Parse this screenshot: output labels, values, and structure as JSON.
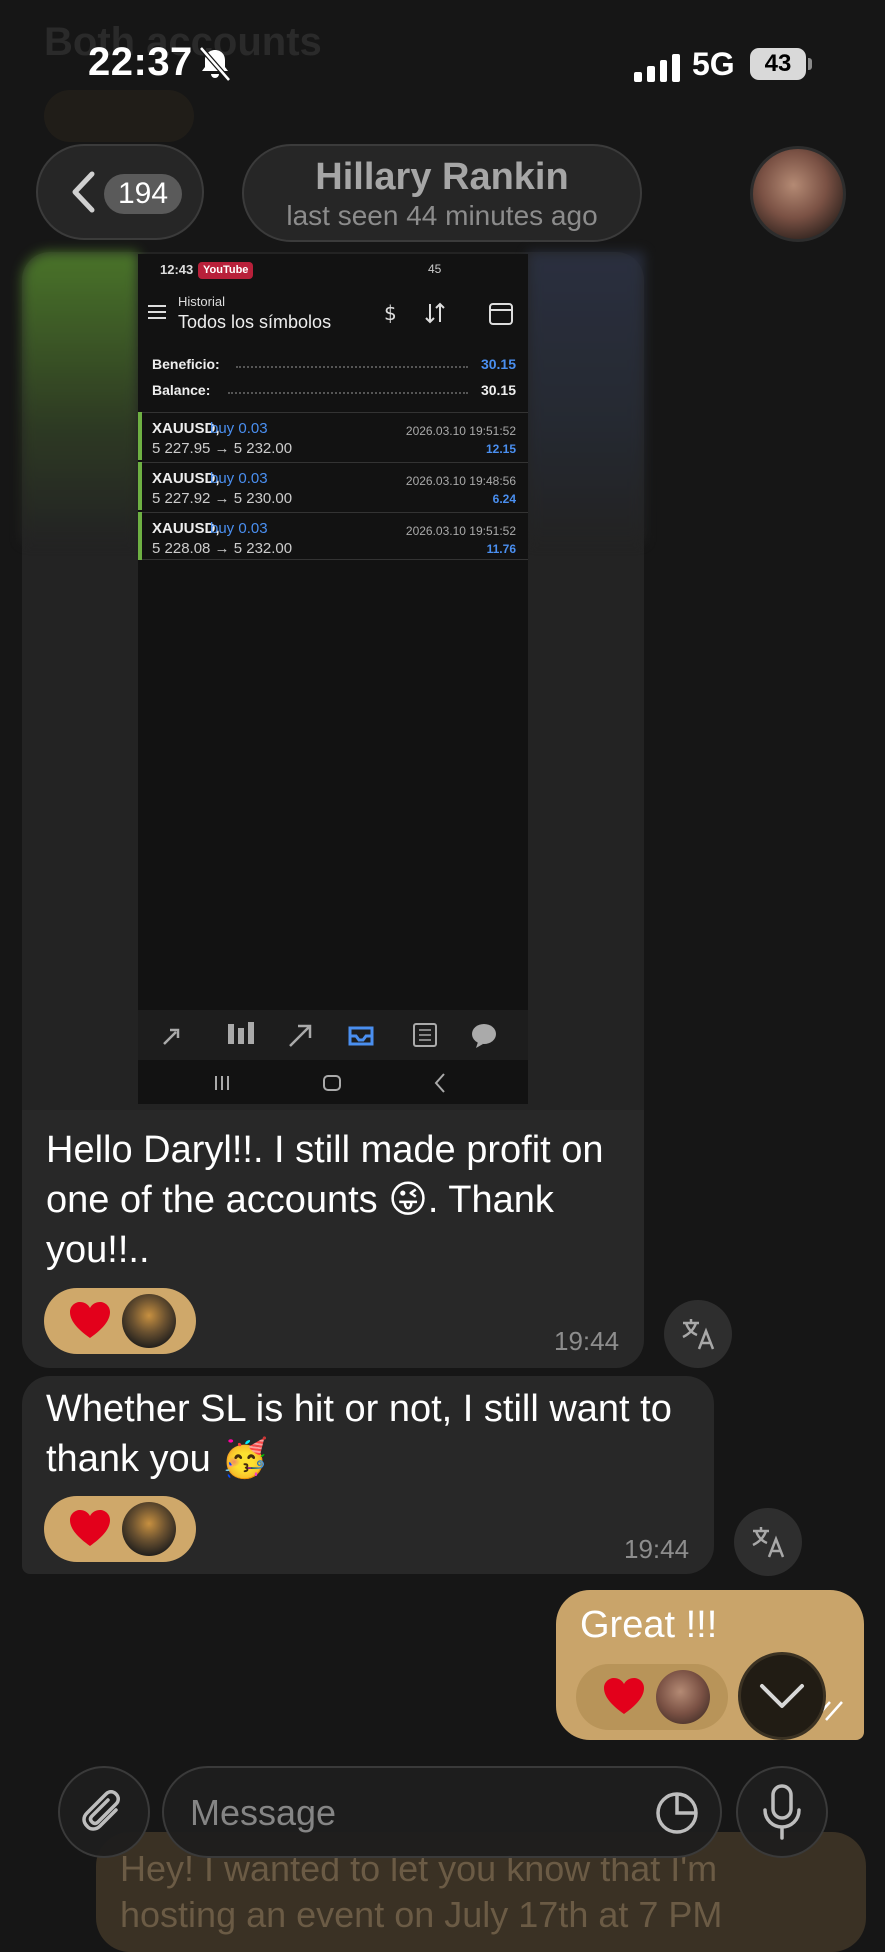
{
  "status_bar": {
    "time": "22:37",
    "network": "5G",
    "battery": "43"
  },
  "header": {
    "back_count": "194",
    "contact_name": "Hillary Rankin",
    "last_seen": "last seen 44 minutes ago"
  },
  "background_ghost": {
    "top_text": "Both accounts",
    "bottom_text": "Hey! I wanted to let you know that I'm hosting an event on July 17th at 7 PM"
  },
  "screenshot": {
    "time": "12:43",
    "app_badge": "YouTube",
    "status_right": "45",
    "subtitle": "Historial",
    "title": "Todos los símbolos",
    "beneficio_label": "Beneficio:",
    "beneficio_value": "30.15",
    "balance_label": "Balance:",
    "balance_value": "30.15",
    "trades": [
      {
        "symbol": "XAUUSD,",
        "side": "buy 0.03",
        "prices": "5 227.95 → 5 232.00",
        "timestamp": "2026.03.10 19:51:52",
        "profit": "12.15"
      },
      {
        "symbol": "XAUUSD,",
        "side": "buy 0.03",
        "prices": "5 227.92 → 5 230.00",
        "timestamp": "2026.03.10 19:48:56",
        "profit": "6.24"
      },
      {
        "symbol": "XAUUSD,",
        "side": "buy 0.03",
        "prices": "5 228.08 → 5 232.00",
        "timestamp": "2026.03.10 19:51:52",
        "profit": "11.76"
      }
    ]
  },
  "messages": [
    {
      "text": "Hello Daryl!!. I still made profit on one of the accounts 😜. Thank you!!..",
      "time": "19:44",
      "reaction": "heart"
    },
    {
      "text": "Whether SL is hit or not, I still want to thank you 🥳",
      "time": "19:44",
      "reaction": "heart"
    }
  ],
  "outgoing": {
    "text": "Great !!!",
    "reaction": "heart"
  },
  "input": {
    "placeholder": "Message"
  },
  "colors": {
    "accent": "#cfa86a",
    "outgoing_bubble": "#c9a46a",
    "incoming_bubble": "#282828",
    "background": "#161616"
  }
}
